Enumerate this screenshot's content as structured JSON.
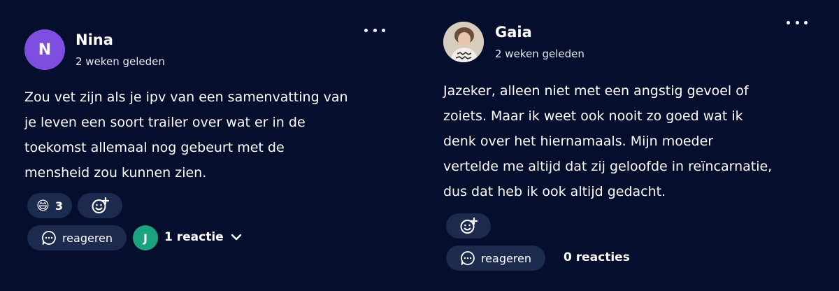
{
  "colors": {
    "background": "#050e2c",
    "pill": "#1c2a4e",
    "nina_avatar": "#7e4ee0",
    "replier_avatar": "#1aa37f"
  },
  "comments": [
    {
      "author": "Nina",
      "avatar_initial": "N",
      "time": "2 weken geleden",
      "text": "Zou vet zijn als je ipv van een samenvatting van\nje leven een soort trailer over wat er in de\ntoekomst allemaal nog gebeurt met de\nmensheid zou kunnen zien.",
      "reaction_emoji": "😄",
      "reaction_count": "3",
      "add_reaction_icon": "add-emoji-icon",
      "reply_label": "reageren",
      "replier_initial": "J",
      "reactions_label": "1 reactie"
    },
    {
      "author": "Gaia",
      "avatar_icon": "profile-photo",
      "time": "2 weken geleden",
      "text": "Jazeker, alleen niet met een angstig gevoel of\nzoiets. Maar ik weet ook nooit zo goed wat ik\ndenk over het hiernamaals. Mijn moeder\nvertelde me altijd dat zij geloofde in reïncarnatie,\ndus dat heb ik ook altijd gedacht.",
      "add_reaction_icon": "add-emoji-icon",
      "reply_label": "reageren",
      "reactions_label": "0 reacties"
    }
  ]
}
